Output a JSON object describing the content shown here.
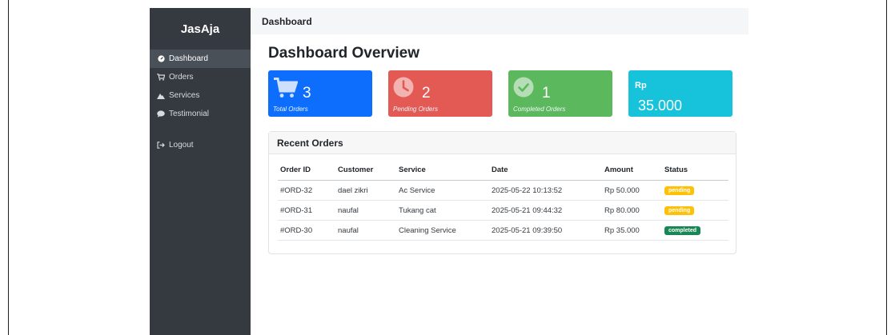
{
  "app": {
    "brand": "JasAja"
  },
  "sidebar": {
    "items": [
      {
        "label": "Dashboard",
        "icon": "dashboard-icon",
        "active": true
      },
      {
        "label": "Orders",
        "icon": "cart-icon"
      },
      {
        "label": "Services",
        "icon": "mountain-icon"
      },
      {
        "label": "Testimonial",
        "icon": "comment-icon"
      },
      {
        "label": "Logout",
        "icon": "logout-icon"
      }
    ]
  },
  "topbar": {
    "title": "Dashboard"
  },
  "main": {
    "title": "Dashboard Overview",
    "cards": [
      {
        "value": "3",
        "caption": "Total Orders",
        "color": "#0d6efd",
        "icon": "cart-icon"
      },
      {
        "value": "2",
        "caption": "Pending Orders",
        "color": "#e35a55",
        "icon": "clock-icon"
      },
      {
        "value": "1",
        "caption": "Completed Orders",
        "color": "#5cb85c",
        "icon": "check-circle-icon"
      },
      {
        "prefix": "Rp",
        "value": "35.000",
        "color": "#17c3db"
      }
    ],
    "recent_orders": {
      "title": "Recent Orders",
      "columns": [
        "Order ID",
        "Customer",
        "Service",
        "Date",
        "Amount",
        "Status"
      ],
      "rows": [
        {
          "order_id": "#ORD-32",
          "customer": "dael zikri",
          "service": "Ac Service",
          "date": "2025-05-22 10:13:52",
          "amount": "Rp 50.000",
          "status": "pending"
        },
        {
          "order_id": "#ORD-31",
          "customer": "naufal",
          "service": "Tukang cat",
          "date": "2025-05-21 09:44:32",
          "amount": "Rp 80.000",
          "status": "pending"
        },
        {
          "order_id": "#ORD-30",
          "customer": "naufal",
          "service": "Cleaning Service",
          "date": "2025-05-21 09:39:50",
          "amount": "Rp 35.000",
          "status": "completed"
        }
      ]
    }
  },
  "colors": {
    "sidebar": "#343a40",
    "pending": "#ffc107",
    "completed": "#198754"
  }
}
